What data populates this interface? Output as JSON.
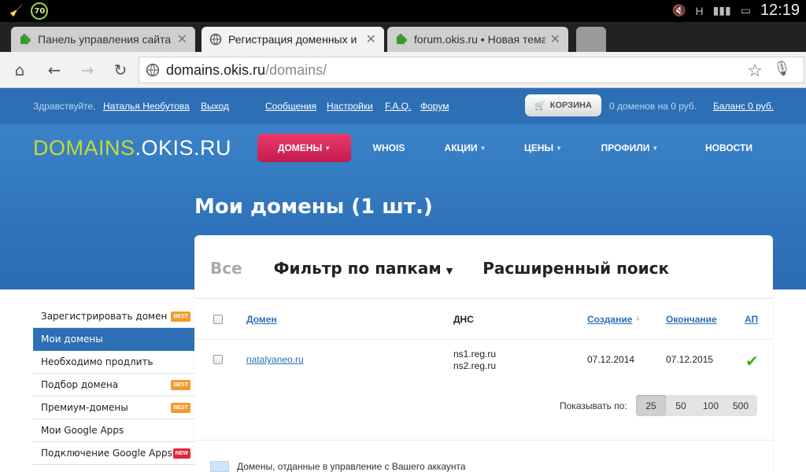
{
  "status_bar": {
    "badge": "70",
    "time": "12:19",
    "network": "H"
  },
  "tabs": [
    {
      "title": "Панель управления сайта",
      "active": false
    },
    {
      "title": "Регистрация доменных и",
      "active": true
    },
    {
      "title": "forum.okis.ru • Новая тема",
      "active": false
    }
  ],
  "address": {
    "host": "domains.okis.ru",
    "path": "/domains/"
  },
  "topbar": {
    "greeting": "Здравствуйте,",
    "user": "Наталья Необутова",
    "logout": "Выход",
    "messages": "Сообщения",
    "settings": "Настройки",
    "faq": "F.A.Q.",
    "forum": "Форум",
    "cart_label": "КОРЗИНА",
    "cart_info": "0 доменов на 0 руб.",
    "balance": "Баланс 0 руб."
  },
  "logo": {
    "part1": "DOMAINS",
    "part2": ".OKIS.RU"
  },
  "nav": [
    {
      "label": "ДОМЕНЫ",
      "active": true,
      "caret": true
    },
    {
      "label": "WHOIS",
      "active": false,
      "caret": false
    },
    {
      "label": "АКЦИИ",
      "active": false,
      "caret": true
    },
    {
      "label": "ЦЕНЫ",
      "active": false,
      "caret": true
    },
    {
      "label": "ПРОФИЛИ",
      "active": false,
      "caret": true
    },
    {
      "label": "НОВОСТИ",
      "active": false,
      "caret": false
    }
  ],
  "page_title": "Мои домены (1 шт.)",
  "sidebar": [
    {
      "label": "Зарегистрировать домен",
      "tag": "BEST"
    },
    {
      "label": "Мои домены",
      "active": true
    },
    {
      "label": "Необходимо продлить"
    },
    {
      "label": "Подбор домена",
      "tag": "BEST"
    },
    {
      "label": "Премиум-домены",
      "tag": "BEST"
    },
    {
      "label": "Мои Google Apps"
    },
    {
      "label": "Подключение Google Apps",
      "tag": "NEW"
    }
  ],
  "filters": {
    "all": "Все",
    "folders": "Фильтр по папкам",
    "advanced": "Расширенный поиск"
  },
  "table": {
    "headers": {
      "domain": "Домен",
      "dns": "ДНС",
      "created": "Создание",
      "sort_indicator": "↓",
      "expires": "Окончание",
      "ap": "АП"
    },
    "rows": [
      {
        "domain": "natalyaneo.ru",
        "dns1": "ns1.reg.ru",
        "dns2": "ns2.reg.ru",
        "created": "07.12.2014",
        "expires": "07.12.2015",
        "ap": true
      }
    ]
  },
  "pagination": {
    "label": "Показывать по:",
    "options": [
      "25",
      "50",
      "100",
      "500"
    ],
    "selected": "25"
  },
  "legend": {
    "text": "Домены, отданные в управление с Вашего аккаунта"
  },
  "colors": {
    "brand_blue": "#2d6fb5",
    "accent_pink": "#d62a5a",
    "logo_green": "#c4dc30",
    "check_green": "#4bab1e"
  }
}
